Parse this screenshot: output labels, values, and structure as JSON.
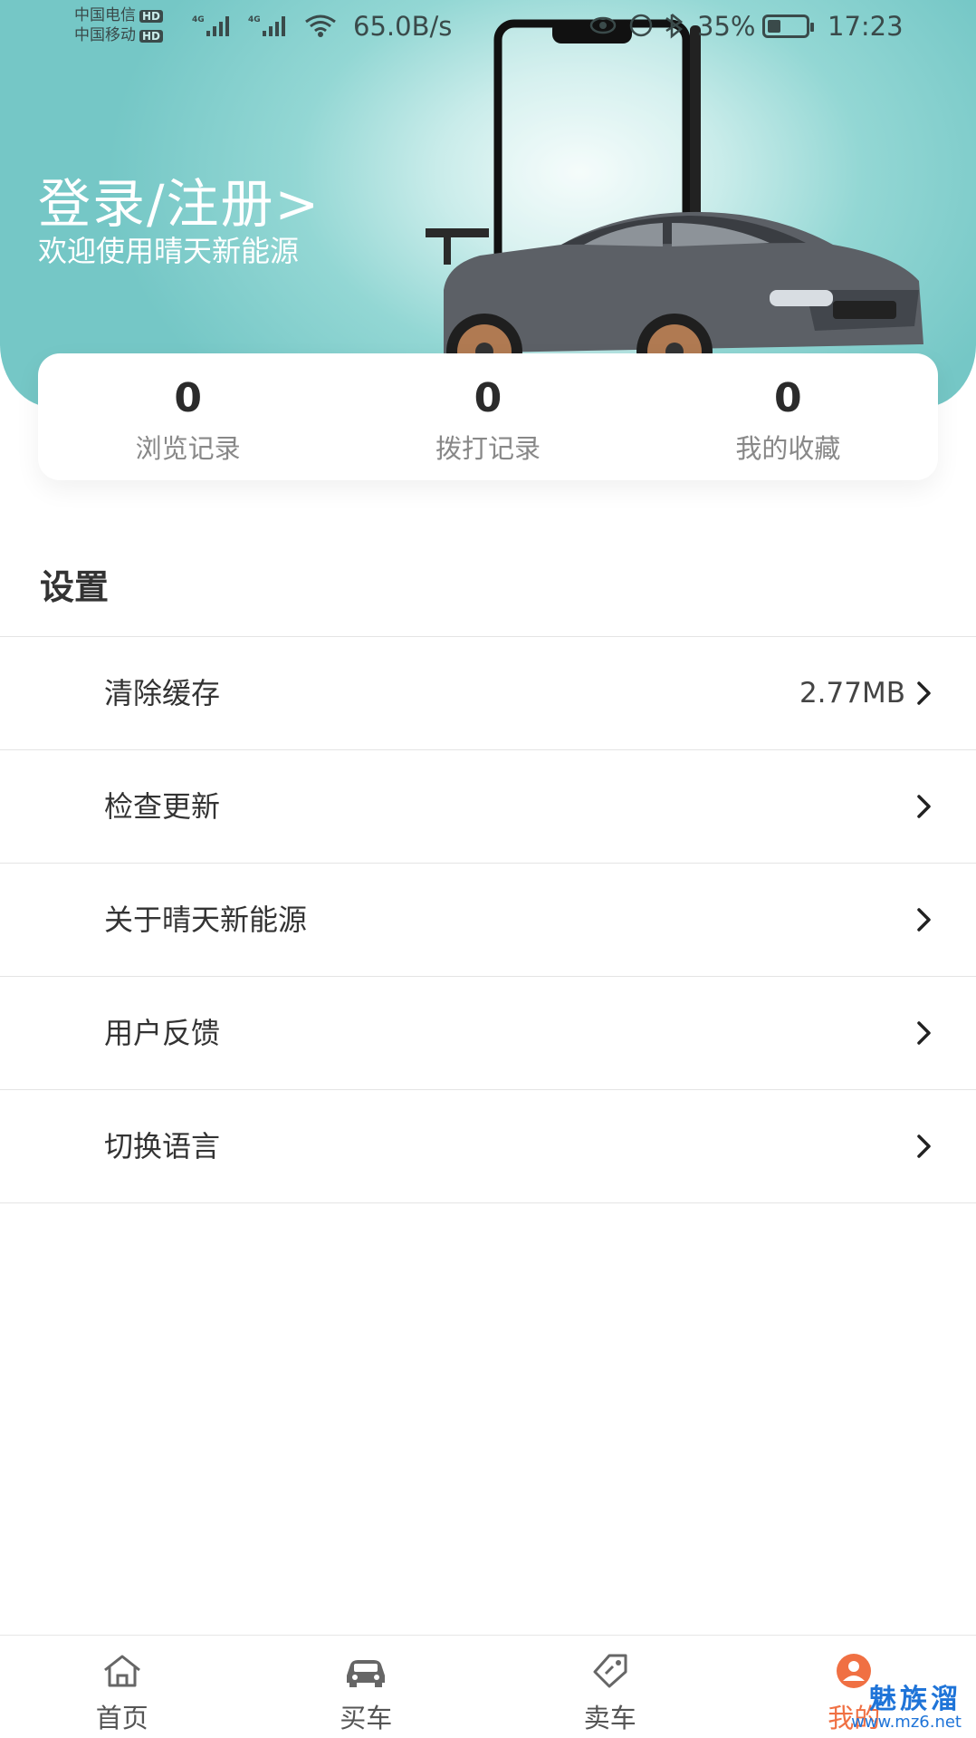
{
  "status_bar": {
    "carrier1": "中国电信",
    "carrier2": "中国移动",
    "hd_badge": "HD",
    "net_type": "4G",
    "net_speed": "65.0B/s",
    "battery_percent": "35%",
    "battery_level": 0.35,
    "time": "17:23"
  },
  "header": {
    "login_link": "登录/注册>",
    "welcome": "欢迎使用晴天新能源"
  },
  "stats": [
    {
      "count": "0",
      "label": "浏览记录"
    },
    {
      "count": "0",
      "label": "拨打记录"
    },
    {
      "count": "0",
      "label": "我的收藏"
    }
  ],
  "settings": {
    "title": "设置",
    "items": [
      {
        "label": "清除缓存",
        "value": "2.77MB"
      },
      {
        "label": "检查更新",
        "value": ""
      },
      {
        "label": "关于晴天新能源",
        "value": ""
      },
      {
        "label": "用户反馈",
        "value": ""
      },
      {
        "label": "切换语言",
        "value": ""
      }
    ]
  },
  "tabbar": {
    "tabs": [
      {
        "label": "首页",
        "icon": "home-icon"
      },
      {
        "label": "买车",
        "icon": "car-icon"
      },
      {
        "label": "卖车",
        "icon": "tag-icon"
      },
      {
        "label": "我的",
        "icon": "profile-icon"
      }
    ],
    "active_color": "#f07043"
  },
  "watermark": {
    "text": "魅族溜",
    "url": "www.mz6.net"
  },
  "colors": {
    "header_teal": "#75c7c6",
    "accent": "#f07043"
  }
}
